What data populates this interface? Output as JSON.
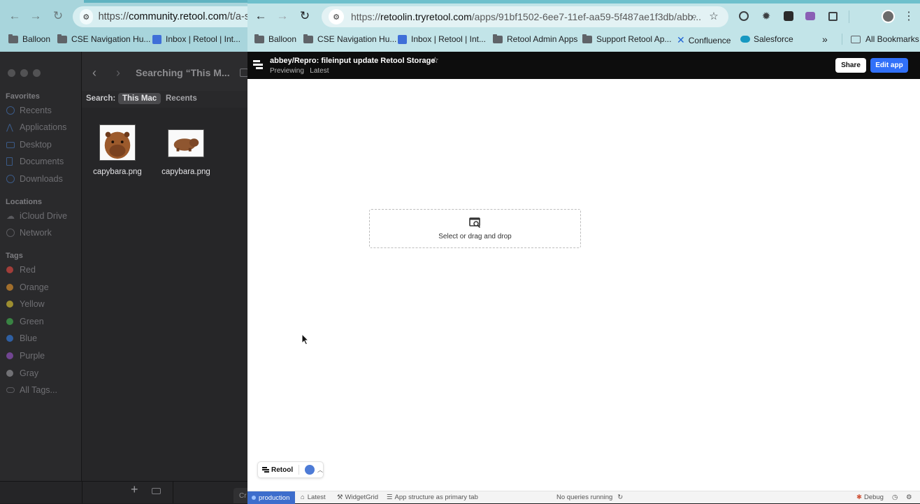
{
  "back_browser": {
    "url_prefix": "https://",
    "url_host": "community.retool.com",
    "url_path": "/t/a-stra",
    "bookmarks": [
      {
        "label": "Balloon"
      },
      {
        "label": "CSE Navigation Hu..."
      },
      {
        "label": "Inbox | Retool | Int..."
      }
    ]
  },
  "finder": {
    "title": "Searching “This M...",
    "sidebar": {
      "favorites_header": "Favorites",
      "favorites": [
        "Recents",
        "Applications",
        "Desktop",
        "Documents",
        "Downloads"
      ],
      "locations_header": "Locations",
      "locations": [
        "iCloud Drive",
        "Network"
      ],
      "tags_header": "Tags",
      "tags": [
        {
          "label": "Red",
          "color": "#c9443d"
        },
        {
          "label": "Orange",
          "color": "#c9852c"
        },
        {
          "label": "Yellow",
          "color": "#c4b032"
        },
        {
          "label": "Green",
          "color": "#3fa14b"
        },
        {
          "label": "Blue",
          "color": "#3171c9"
        },
        {
          "label": "Purple",
          "color": "#8a4fb3"
        },
        {
          "label": "Gray",
          "color": "#8a8a8d"
        }
      ],
      "all_tags": "All Tags..."
    },
    "search_label": "Search:",
    "scope": {
      "this_mac": "This Mac",
      "recents": "Recents"
    },
    "files": [
      {
        "name": "capybara.png"
      },
      {
        "name": "capybara.png"
      }
    ],
    "bottom_partial_text": "Cr"
  },
  "front_browser": {
    "url_prefix": "https://",
    "url_host": "retoolin.tryretool.com",
    "url_path": "/apps/91bf1502-6ee7-11ef-aa59-5f487ae1f3db/abb...",
    "bookmarks": [
      {
        "label": "Balloon"
      },
      {
        "label": "CSE Navigation Hu..."
      },
      {
        "label": "Inbox | Retool | Int..."
      },
      {
        "label": "Retool Admin Apps"
      },
      {
        "label": "Support Retool Ap..."
      },
      {
        "label": "Confluence"
      },
      {
        "label": "Salesforce"
      }
    ],
    "more": "»",
    "all_bookmarks": "All Bookmarks"
  },
  "app": {
    "title": "abbey/Repro: fileinput update Retool Storage",
    "mode": "Previewing",
    "version": "Latest",
    "share_label": "Share",
    "edit_label": "Edit app",
    "dropzone_label": "Select or drag and drop",
    "retool_pill_label": "Retool",
    "status": {
      "env": "production",
      "version": "Latest",
      "widget": "WidgetGrid",
      "structure": "App structure as primary tab",
      "queries": "No queries running",
      "debug": "Debug"
    }
  }
}
